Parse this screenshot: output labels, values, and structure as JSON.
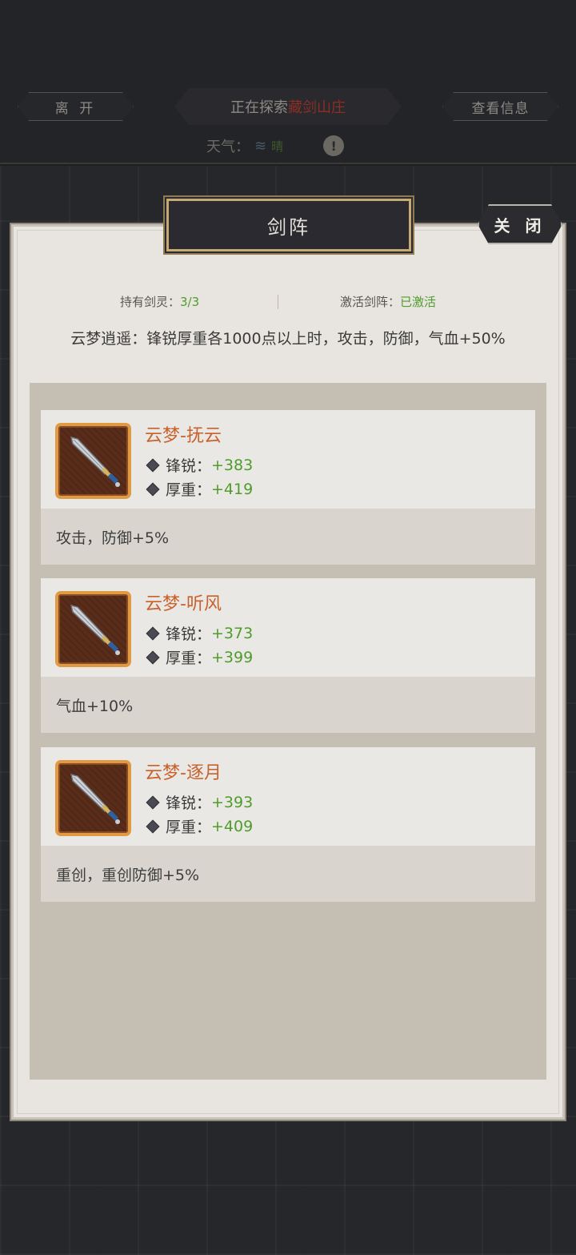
{
  "topbar": {
    "leave_label": "离 开",
    "exploring_prefix": "正在探索",
    "exploring_place": "藏剑山庄",
    "info_label": "查看信息",
    "weather_label": "天气：",
    "weather_icon": "wind-icon",
    "weather_value": "晴",
    "alert_icon": "!"
  },
  "dialog": {
    "title": "剑阵",
    "close_label": "关 闭",
    "owned_label": "持有剑灵：",
    "owned_value": "3/3",
    "active_label": "激活剑阵：",
    "active_value": "已激活",
    "set_description": "云梦逍遥：锋锐厚重各1000点以上时，攻击，防御，气血+50%"
  },
  "swords": [
    {
      "name": "云梦-抚云",
      "attr1_label": "锋锐：",
      "attr1_value": "+383",
      "attr2_label": "厚重：",
      "attr2_value": "+419",
      "bonus": "攻击，防御+5%"
    },
    {
      "name": "云梦-听风",
      "attr1_label": "锋锐：",
      "attr1_value": "+373",
      "attr2_label": "厚重：",
      "attr2_value": "+399",
      "bonus": "气血+10%"
    },
    {
      "name": "云梦-逐月",
      "attr1_label": "锋锐：",
      "attr1_value": "+393",
      "attr2_label": "厚重：",
      "attr2_value": "+409",
      "bonus": "重创，重创防御+5%"
    }
  ],
  "colors": {
    "accent_orange": "#c9612c",
    "value_green": "#4f9c2c",
    "place_red": "#8a2e26"
  }
}
